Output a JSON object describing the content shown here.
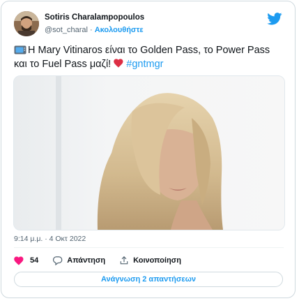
{
  "author": {
    "name": "Sotiris Charalampopoulos",
    "handle": "@sot_charal",
    "separator": "·",
    "follow_label": "Ακολουθήστε"
  },
  "tweet": {
    "text_line1": "Η Mary Vitinaros είναι το Golden Pass, το Power Pass",
    "text_line2": "και το Fuel Pass μαζί!",
    "hashtag": "#gntmgr",
    "timestamp": "9:14 μ.μ. · 4 Οκτ 2022"
  },
  "actions": {
    "like_count": "54",
    "reply_label": "Απάντηση",
    "share_label": "Κοινοποίηση"
  },
  "replies_button_label": "Ανάγνωση 2 απαντήσεων",
  "colors": {
    "accent": "#1d9bf0",
    "heart": "#e0245e",
    "text": "#0f1419",
    "secondary": "#536471"
  },
  "icons": [
    "twitter-bird-icon",
    "tv-emoji-icon",
    "red-heart-emoji-icon",
    "heart-icon",
    "reply-icon",
    "share-icon"
  ]
}
